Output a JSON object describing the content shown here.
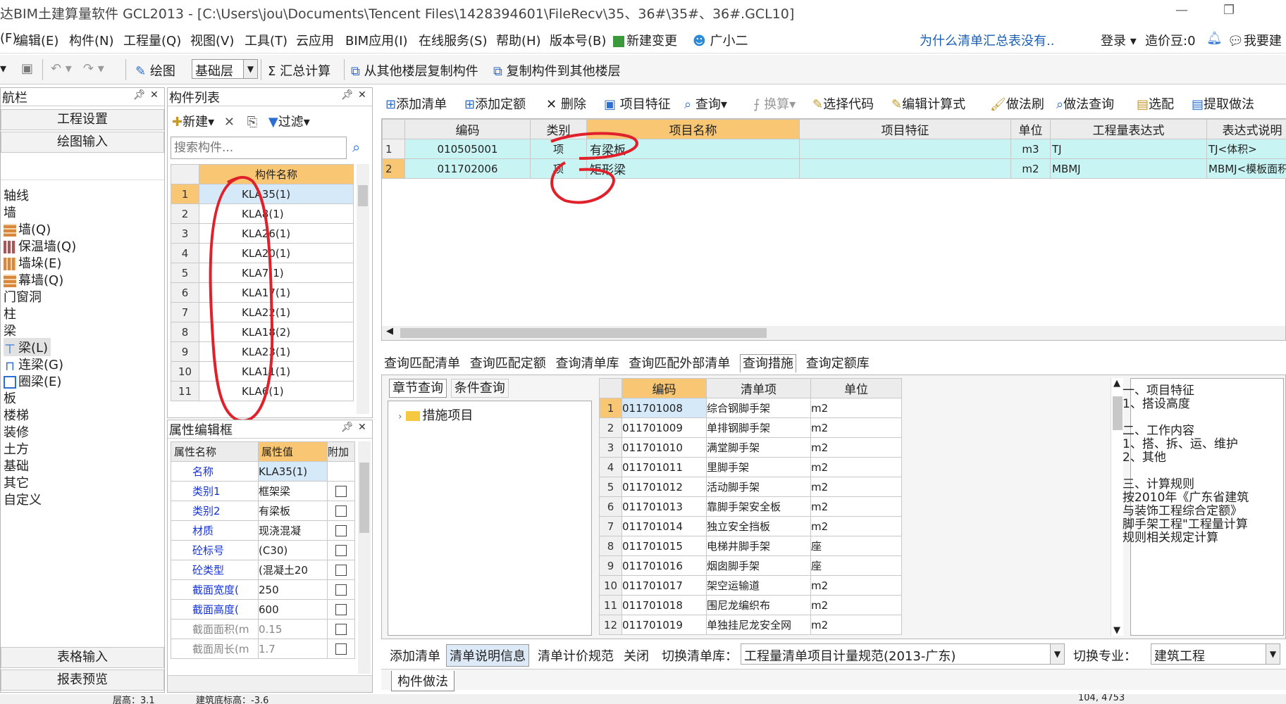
{
  "window": {
    "title": "达BIM土建算量软件 GCL2013 - [C:\\Users\\jou\\Documents\\Tencent Files\\1428394601\\FileRecv\\35、36#\\35#、36#.GCL10]"
  },
  "menu": {
    "items": [
      "(F)",
      "编辑(E)",
      "构件(N)",
      "工程量(Q)",
      "视图(V)",
      "工具(T)",
      "云应用",
      "BIM应用(I)",
      "在线服务(S)",
      "帮助(H)",
      "版本号(B)",
      "新建变更",
      "广小二"
    ],
    "notice": "为什么清单汇总表没有..",
    "login": "登录",
    "price_bean": "造价豆:0",
    "help": "我要建"
  },
  "toolbar": {
    "draw": "绘图",
    "floor": "基础层",
    "sum": "汇总计算",
    "copy_from": "从其他楼层复制构件",
    "copy_to": "复制构件到其他楼层"
  },
  "nav": {
    "title": "航栏",
    "project_settings": "工程设置",
    "drawing_input": "绘图输入",
    "items": [
      "轴线",
      "墙",
      "墙(Q)",
      "保温墙(Q)",
      "墙垛(E)",
      "幕墙(Q)",
      "门窗洞",
      "柱",
      "梁",
      "梁(L)",
      "连梁(G)",
      "圈梁(E)",
      "板",
      "楼梯",
      "装修",
      "土方",
      "基础",
      "其它",
      "自定义"
    ],
    "table_input": "表格输入",
    "report_preview": "报表预览"
  },
  "component_list": {
    "title": "构件列表",
    "new_btn": "新建",
    "filter_btn": "过滤",
    "search_placeholder": "搜索构件...",
    "col_name": "构件名称",
    "rows": [
      "KLA35(1)",
      "KLA8(1)",
      "KLA26(1)",
      "KLA20(1)",
      "KLA7(1)",
      "KLA17(1)",
      "KLA22(1)",
      "KLA18(2)",
      "KLA23(1)",
      "KLA11(1)",
      "KLA6(1)"
    ]
  },
  "props": {
    "title": "属性编辑框",
    "col_name": "属性名称",
    "col_value": "属性值",
    "col_extra": "附加",
    "rows": [
      {
        "name": "名称",
        "value": "KLA35(1)"
      },
      {
        "name": "类别1",
        "value": "框架梁"
      },
      {
        "name": "类别2",
        "value": "有梁板"
      },
      {
        "name": "材质",
        "value": "现浇混凝"
      },
      {
        "name": "砼标号",
        "value": "(C30)"
      },
      {
        "name": "砼类型",
        "value": "(混凝土20"
      },
      {
        "name": "截面宽度(",
        "value": "250"
      },
      {
        "name": "截面高度(",
        "value": "600"
      },
      {
        "name": "截面面积(m",
        "value": "0.15"
      },
      {
        "name": "截面周长(m",
        "value": "1.7"
      }
    ]
  },
  "method_toolbar": {
    "add_list": "添加清单",
    "add_quota": "添加定额",
    "delete": "删除",
    "item_feature": "项目特征",
    "query": "查询",
    "convert": "换算",
    "select_code": "选择代码",
    "edit_formula": "编辑计算式",
    "method_brush": "做法刷",
    "method_query": "做法查询",
    "select_match": "选配",
    "extract": "提取做法"
  },
  "method_table": {
    "headers": [
      "编码",
      "类别",
      "项目名称",
      "项目特征",
      "单位",
      "工程量表达式",
      "表达式说明"
    ],
    "rows": [
      {
        "no": "1",
        "code": "010505001",
        "type": "项",
        "name": "有梁板",
        "feature": "",
        "unit": "m3",
        "expr": "TJ",
        "desc": "TJ<体积>"
      },
      {
        "no": "2",
        "code": "011702006",
        "type": "项",
        "name": "矩形梁",
        "feature": "",
        "unit": "m2",
        "expr": "MBMJ",
        "desc": "MBMJ<模板面积>"
      }
    ]
  },
  "query_tabs": [
    "查询匹配清单",
    "查询匹配定额",
    "查询清单库",
    "查询匹配外部清单",
    "查询措施",
    "查询定额库"
  ],
  "sub_tabs": [
    "章节查询",
    "条件查询"
  ],
  "tree": {
    "node": "措施项目"
  },
  "list_table": {
    "headers": [
      "编码",
      "清单项",
      "单位"
    ],
    "rows": [
      {
        "no": "1",
        "code": "011701008",
        "name": "综合钢脚手架",
        "unit": "m2"
      },
      {
        "no": "2",
        "code": "011701009",
        "name": "单排钢脚手架",
        "unit": "m2"
      },
      {
        "no": "3",
        "code": "011701010",
        "name": "满堂脚手架",
        "unit": "m2"
      },
      {
        "no": "4",
        "code": "011701011",
        "name": "里脚手架",
        "unit": "m2"
      },
      {
        "no": "5",
        "code": "011701012",
        "name": "活动脚手架",
        "unit": "m2"
      },
      {
        "no": "6",
        "code": "011701013",
        "name": "靠脚手架安全板",
        "unit": "m2"
      },
      {
        "no": "7",
        "code": "011701014",
        "name": "独立安全挡板",
        "unit": "m2"
      },
      {
        "no": "8",
        "code": "011701015",
        "name": "电梯井脚手架",
        "unit": "座"
      },
      {
        "no": "9",
        "code": "011701016",
        "name": "烟囱脚手架",
        "unit": "座"
      },
      {
        "no": "10",
        "code": "011701017",
        "name": "架空运输道",
        "unit": "m2"
      },
      {
        "no": "11",
        "code": "011701018",
        "name": "围尼龙编织布",
        "unit": "m2"
      },
      {
        "no": "12",
        "code": "011701019",
        "name": "单独挂尼龙安全网",
        "unit": "m2"
      }
    ]
  },
  "description": {
    "lines": [
      "一、项目特征",
      "1、搭设高度",
      "",
      "二、工作内容",
      "1、搭、拆、运、维护",
      "2、其他",
      "",
      "三、计算规则",
      "  按2010年《广东省建筑",
      "与装饰工程综合定额》",
      "脚手架工程\"工程量计算",
      "规则相关规定计算"
    ]
  },
  "bottom_bar": {
    "add_list": "添加清单",
    "list_info": "清单说明信息",
    "pricing_rule": "清单计价规范",
    "close": "关闭",
    "switch_lib_label": "切换清单库：",
    "switch_lib_value": "工程量清单项目计量规范(2013-广东)",
    "switch_major_label": "切换专业：",
    "switch_major_value": "建筑工程"
  },
  "bottom_tab": "构件做法",
  "status": {
    "floor": "层高：3.1",
    "bottom_elev": "建筑底标高：-3.6",
    "coord": "104, 4753"
  }
}
